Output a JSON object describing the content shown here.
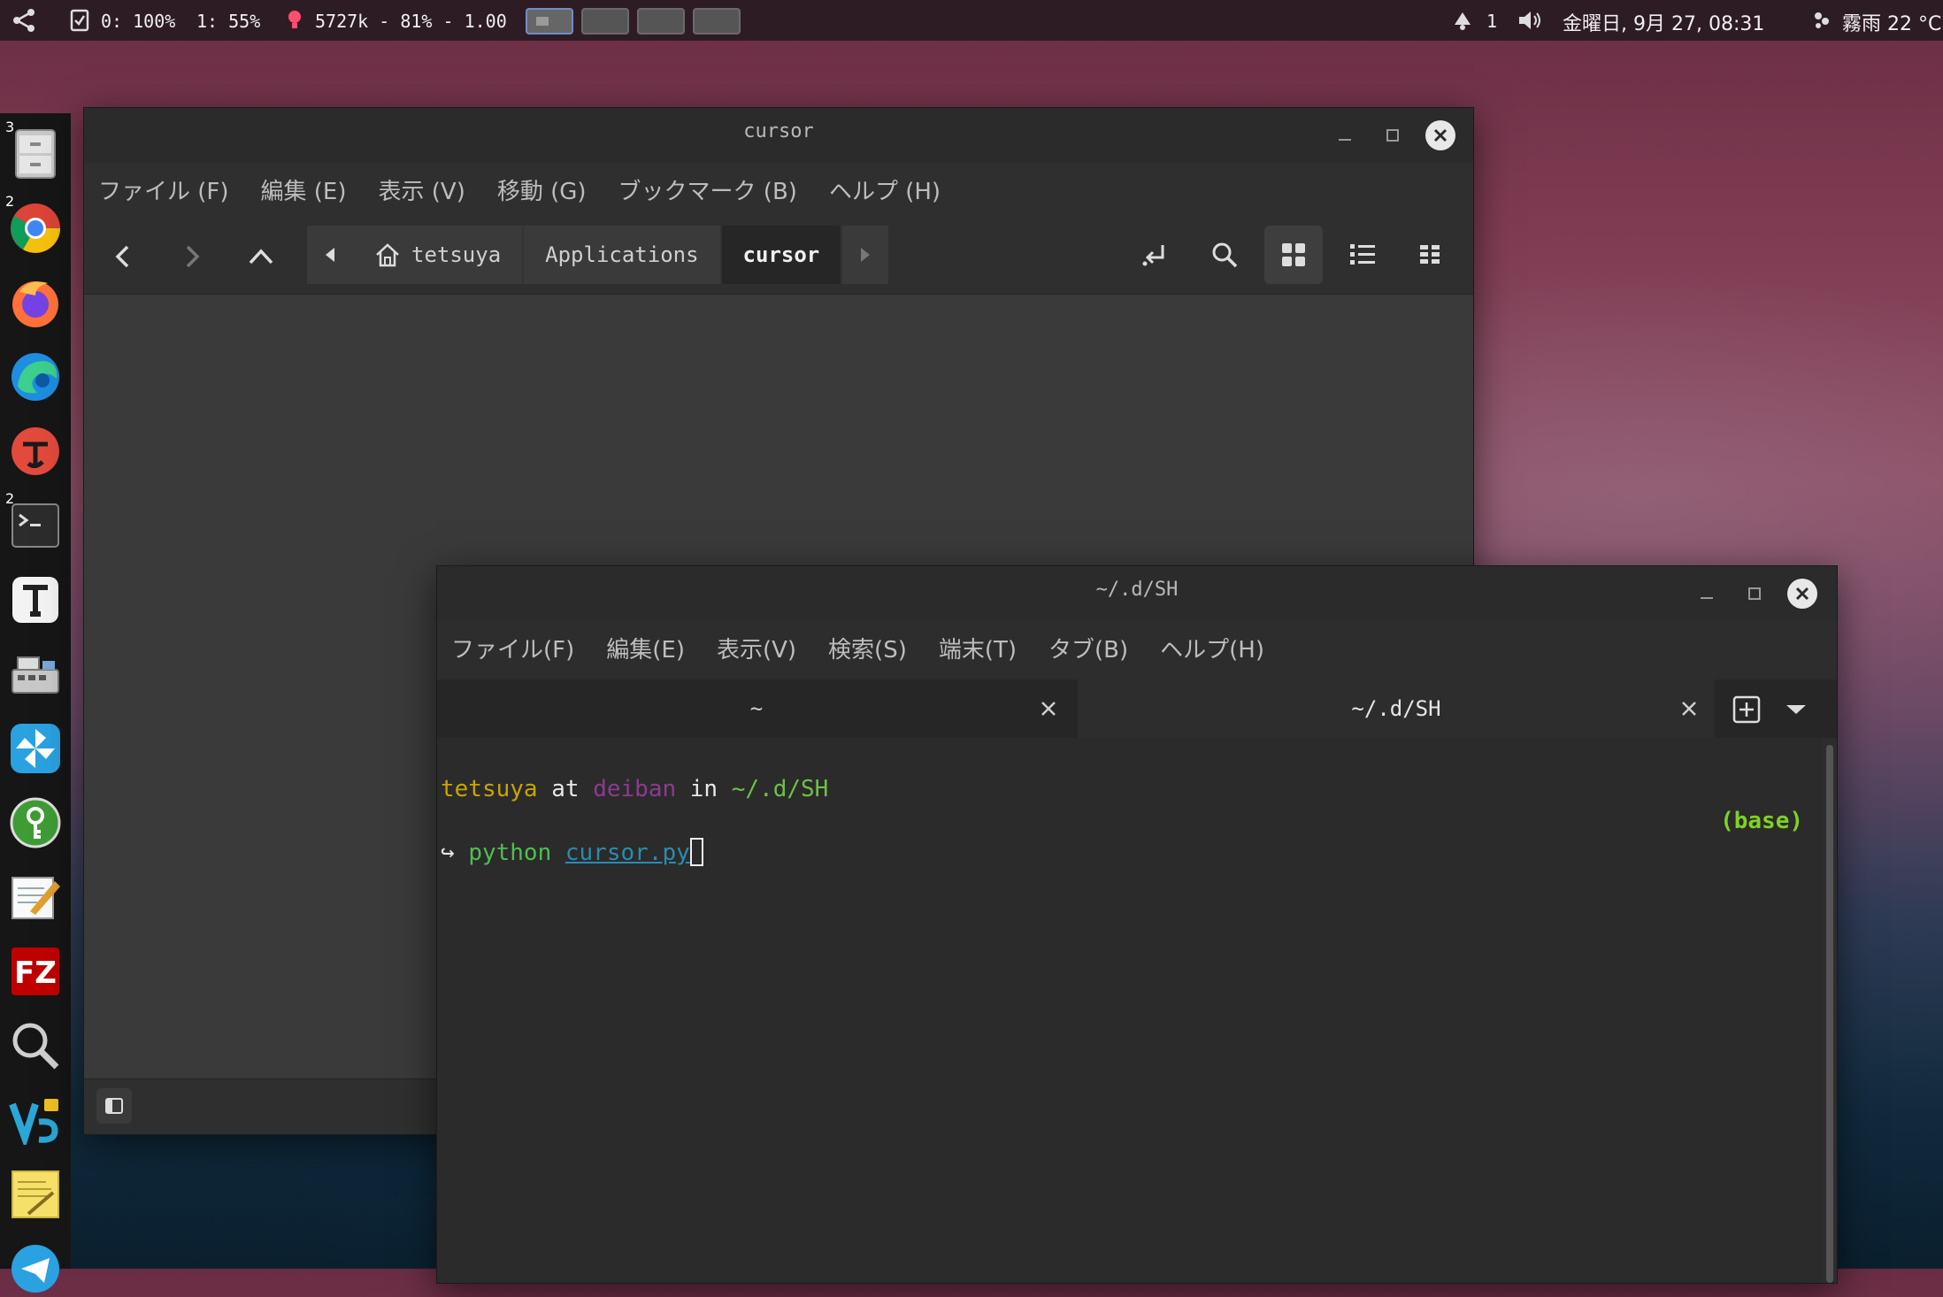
{
  "topbar": {
    "cpu0": "0: 100%",
    "cpu1": "1: 55%",
    "memory": "5727k - 81% - 1.00",
    "notifications": "1",
    "datetime": "金曜日, 9月 27, 08:31",
    "weather": "霧雨 22 °C"
  },
  "dock": {
    "badges": {
      "files": "3",
      "chrome": "2",
      "terminal": "2"
    }
  },
  "file_manager": {
    "title": "cursor",
    "menu": [
      "ファイル (F)",
      "編集 (E)",
      "表示 (V)",
      "移動 (G)",
      "ブックマーク (B)",
      "ヘルプ (H)"
    ],
    "breadcrumbs": [
      "tetsuya",
      "Applications",
      "cursor"
    ]
  },
  "terminal": {
    "title": "~/.d/SH",
    "menu": [
      "ファイル(F)",
      "編集(E)",
      "表示(V)",
      "検索(S)",
      "端末(T)",
      "タブ(B)",
      "ヘルプ(H)"
    ],
    "tabs": [
      {
        "label": "~"
      },
      {
        "label": "~/.d/SH"
      }
    ],
    "prompt": {
      "user": "tetsuya",
      "at": "at",
      "host": "deiban",
      "in": "in",
      "path": "~/.d/SH",
      "arrow": "↪",
      "command": "python",
      "argument": "cursor.py",
      "env": "(base)"
    },
    "colors": {
      "user": "#c8a600",
      "host": "#8e3a8e",
      "path": "#6fbf4a",
      "command": "#4fbf4f",
      "argument": "#2a8bb0",
      "env": "#7ed321"
    }
  }
}
